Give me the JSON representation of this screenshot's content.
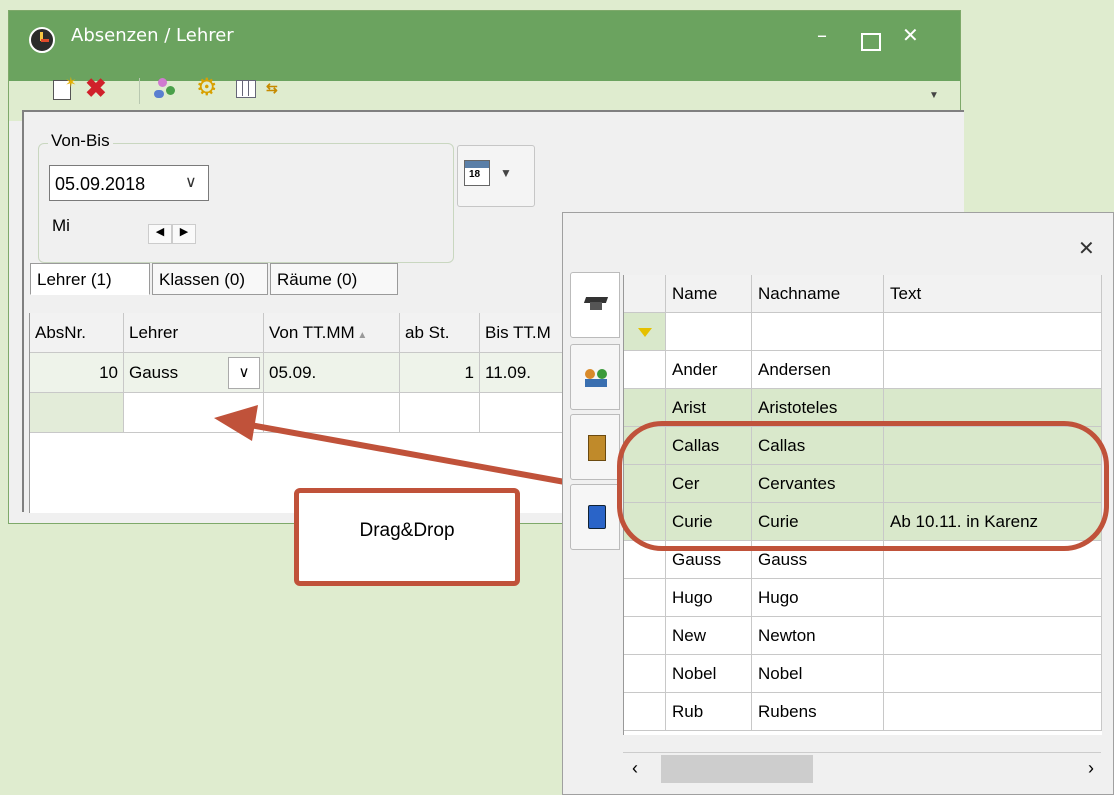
{
  "window": {
    "title": "Absenzen / Lehrer",
    "minimize_icon": "minimize-icon",
    "maximize_icon": "maximize-icon",
    "close_icon": "close-icon",
    "accent": "#6ba35f"
  },
  "toolbar": {
    "icons": [
      "new-icon",
      "delete-icon",
      "users-icon",
      "settings-icon",
      "columns-icon",
      "swap-icon"
    ],
    "overflow_icon": "chevron-down-icon"
  },
  "range": {
    "label": "Von-Bis",
    "date": "05.09.2018",
    "weekday": "Mi",
    "calendar_icon": "calendar-icon"
  },
  "tabs": [
    "Lehrer (1)",
    "Klassen (0)",
    "Räume (0)"
  ],
  "grid": {
    "columns": [
      "AbsNr.",
      "Lehrer",
      "Von TT.MM",
      "ab St.",
      "Bis TT.M"
    ],
    "rows": [
      {
        "absnr": "10",
        "lehrer": "Gauss",
        "von": "05.09.",
        "ab": "1",
        "bis": "11.09."
      }
    ]
  },
  "callout": {
    "text": "Drag&Drop",
    "color": "#c0523a"
  },
  "popup": {
    "columns": [
      "Name",
      "Nachname",
      "Text"
    ],
    "rows": [
      {
        "name": "Ander",
        "nachname": "Andersen",
        "text": ""
      },
      {
        "name": "Arist",
        "nachname": "Aristoteles",
        "text": ""
      },
      {
        "name": "Callas",
        "nachname": "Callas",
        "text": ""
      },
      {
        "name": "Cer",
        "nachname": "Cervantes",
        "text": ""
      },
      {
        "name": "Curie",
        "nachname": "Curie",
        "text": "Ab 10.11. in Karenz"
      },
      {
        "name": "Gauss",
        "nachname": "Gauss",
        "text": ""
      },
      {
        "name": "Hugo",
        "nachname": "Hugo",
        "text": ""
      },
      {
        "name": "New",
        "nachname": "Newton",
        "text": ""
      },
      {
        "name": "Nobel",
        "nachname": "Nobel",
        "text": ""
      },
      {
        "name": "Rub",
        "nachname": "Rubens",
        "text": ""
      }
    ],
    "side_tabs": [
      "teacher-icon",
      "students-icon",
      "room-icon",
      "subject-icon"
    ]
  }
}
